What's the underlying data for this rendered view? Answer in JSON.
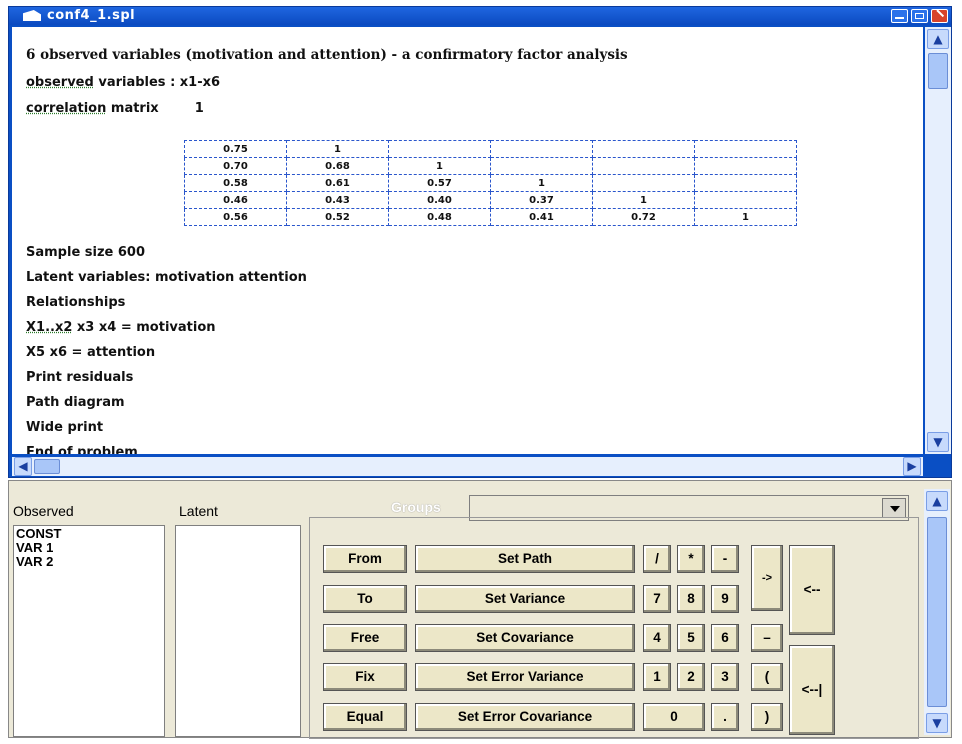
{
  "window": {
    "title": "conf4_1.spl"
  },
  "editor": {
    "heading": "6 observed variables (motivation and attention) - a confirmatory factor analysis",
    "observed_label": "observed",
    "observed_rest": " variables : x1-x6",
    "correlation_label": "correlation",
    "correlation_rest": " matrix",
    "correlation_first": "1",
    "matrix": [
      [
        "0.75",
        "1",
        "",
        "",
        "",
        ""
      ],
      [
        "0.70",
        "0.68",
        "1",
        "",
        "",
        ""
      ],
      [
        "0.58",
        "0.61",
        "0.57",
        "1",
        "",
        ""
      ],
      [
        "0.46",
        "0.43",
        "0.40",
        "0.37",
        "1",
        ""
      ],
      [
        "0.56",
        "0.52",
        "0.48",
        "0.41",
        "0.72",
        "1"
      ]
    ],
    "sample_size": "Sample size 600",
    "latent_line": "Latent variables: motivation  attention",
    "relationships": "Relationships",
    "rel_x1x2": "X1..x2",
    "rel1_rest": "  x3  x4 = motivation",
    "rel2": "X5 x6 = attention",
    "print_residuals": "Print residuals",
    "path_diagram": "Path diagram",
    "wide_print": "Wide print",
    "end": "End of problem"
  },
  "panel": {
    "observed_label": "Observed",
    "latent_label": "Latent",
    "groups_label": "Groups",
    "observed_items": [
      "CONST",
      "VAR 1",
      "VAR 2"
    ],
    "buttons": {
      "from": "From",
      "to": "To",
      "free": "Free",
      "fix": "Fix",
      "equal": "Equal",
      "set_path": "Set Path",
      "set_variance": "Set Variance",
      "set_covariance": "Set Covariance",
      "set_error_variance": "Set Error Variance",
      "set_error_covariance": "Set Error Covariance",
      "slash": "/",
      "star": "*",
      "minus": "-",
      "k7": "7",
      "k8": "8",
      "k9": "9",
      "k4": "4",
      "k5": "5",
      "k6": "6",
      "k1": "1",
      "k2": "2",
      "k3": "3",
      "k0": "0",
      "dot": ".",
      "arrow_right": "->",
      "dash": "–",
      "lparen": "(",
      "rparen": ")",
      "arrow_back": "<--",
      "arrow_back_bar": "<--|"
    }
  },
  "colors": {
    "titlebar": "#0b4ac0",
    "panel": "#ece9d8",
    "button": "#ece7c8"
  }
}
